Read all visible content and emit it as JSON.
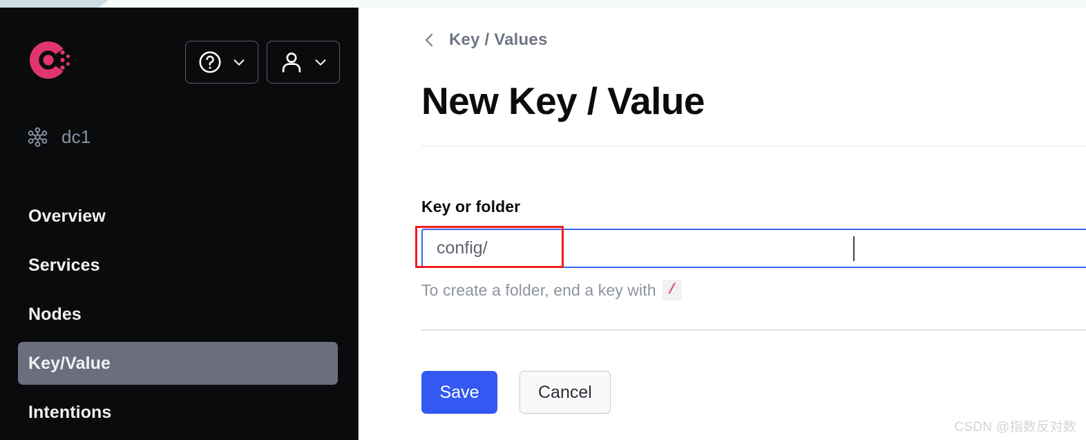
{
  "browser": {
    "tab_strip_color": "#cddde2",
    "tab_color": "#f4f9fa"
  },
  "sidebar": {
    "background": "#0a0b0d",
    "logo": {
      "name": "consul-logo",
      "color": "#e0356f"
    },
    "header_buttons": [
      {
        "name": "help-menu-button",
        "icon": "question-circle-icon",
        "chevron": "chevron-down-icon"
      },
      {
        "name": "user-menu-button",
        "icon": "person-icon",
        "chevron": "chevron-down-icon"
      }
    ],
    "datacenter": {
      "icon": "network-nodes-icon",
      "label": "dc1"
    },
    "nav_items": [
      {
        "label": "Overview",
        "active": false
      },
      {
        "label": "Services",
        "active": false
      },
      {
        "label": "Nodes",
        "active": false
      },
      {
        "label": "Key/Value",
        "active": true
      },
      {
        "label": "Intentions",
        "active": false
      }
    ],
    "active_item_color": "#6b6f7d"
  },
  "main": {
    "breadcrumb": {
      "back_icon": "chevron-left-icon",
      "label": "Key / Values"
    },
    "page_title": "New Key / Value",
    "form": {
      "field_label": "Key or folder",
      "input": {
        "value": "config/",
        "placeholder": "",
        "focus_border_color": "#3b63f0"
      },
      "hint_prefix": "To create a folder, end a key with",
      "hint_badge": "/",
      "hint_badge_color": "#e0457b"
    },
    "actions": {
      "save_label": "Save",
      "save_color": "#3359f2",
      "cancel_label": "Cancel"
    }
  },
  "annotation": {
    "name": "red-highlight-box",
    "color": "#ef1d1d"
  },
  "watermark": "CSDN @指数反对数"
}
